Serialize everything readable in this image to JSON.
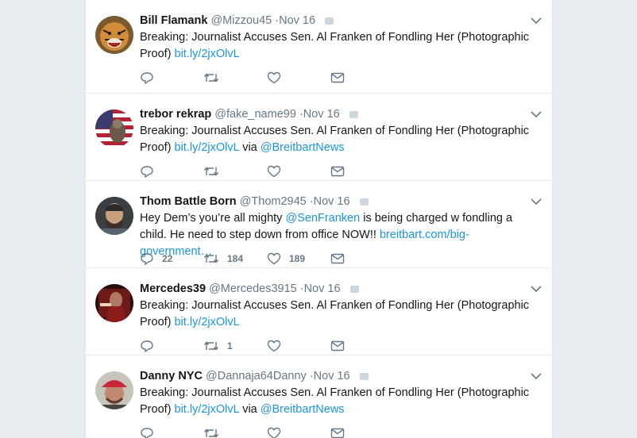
{
  "tweets": [
    {
      "name": "Bill Flamank",
      "handle": "@Mizzou45",
      "time": "Nov 16",
      "text_parts": [
        "Breaking: Journalist Accuses Sen. Al Franken of Fondling Her (Photographic Proof) "
      ],
      "link1": "bit.ly/2jxOlvL",
      "mid": "",
      "link2": "",
      "reply_count": "",
      "retweet_count": "",
      "like_count": "",
      "avatar_icon": "tiger-avatar"
    },
    {
      "name": "trebor rekrap",
      "handle": "@fake_name99",
      "time": "Nov 16",
      "text_parts": [
        "Breaking: Journalist Accuses Sen. Al Franken of Fondling Her (Photographic Proof) "
      ],
      "link1": "bit.ly/2jxOlvL",
      "mid": " via ",
      "link2": "@BreitbartNews",
      "reply_count": "",
      "retweet_count": "",
      "like_count": "",
      "avatar_icon": "flag-avatar"
    },
    {
      "name": "Thom Battle Born",
      "handle": "@Thom2945",
      "time": "Nov 16",
      "text_parts": [
        "Hey Dem’s you’re all mighty "
      ],
      "link1": "@SenFranken",
      "mid": " is being charged w fondling a child. He need to step down from office NOW!! ",
      "link2": "breitbart.com/big-government…",
      "reply_count": "22",
      "retweet_count": "184",
      "like_count": "189",
      "avatar_icon": "man-avatar"
    },
    {
      "name": "Mercedes39",
      "handle": "@Mercedes3915",
      "time": "Nov 16",
      "text_parts": [
        "Breaking: Journalist Accuses Sen. Al Franken of Fondling Her (Photographic Proof) "
      ],
      "link1": "bit.ly/2jxOlvL",
      "mid": "",
      "link2": "",
      "reply_count": "",
      "retweet_count": "1",
      "like_count": "",
      "avatar_icon": "red-avatar"
    },
    {
      "name": "Danny NYC",
      "handle": "@Dannaja64Danny",
      "time": "Nov 16",
      "text_parts": [
        "Breaking: Journalist Accuses Sen. Al Franken of Fondling Her (Photographic Proof) "
      ],
      "link1": "bit.ly/2jxOlvL",
      "mid": " via ",
      "link2": "@BreitbartNews",
      "reply_count": "",
      "retweet_count": "",
      "like_count": "",
      "avatar_icon": "cap-avatar"
    }
  ],
  "sep": "·",
  "colors": {
    "link": "#1b95e0",
    "muted": "#657786",
    "text": "#14171a"
  }
}
